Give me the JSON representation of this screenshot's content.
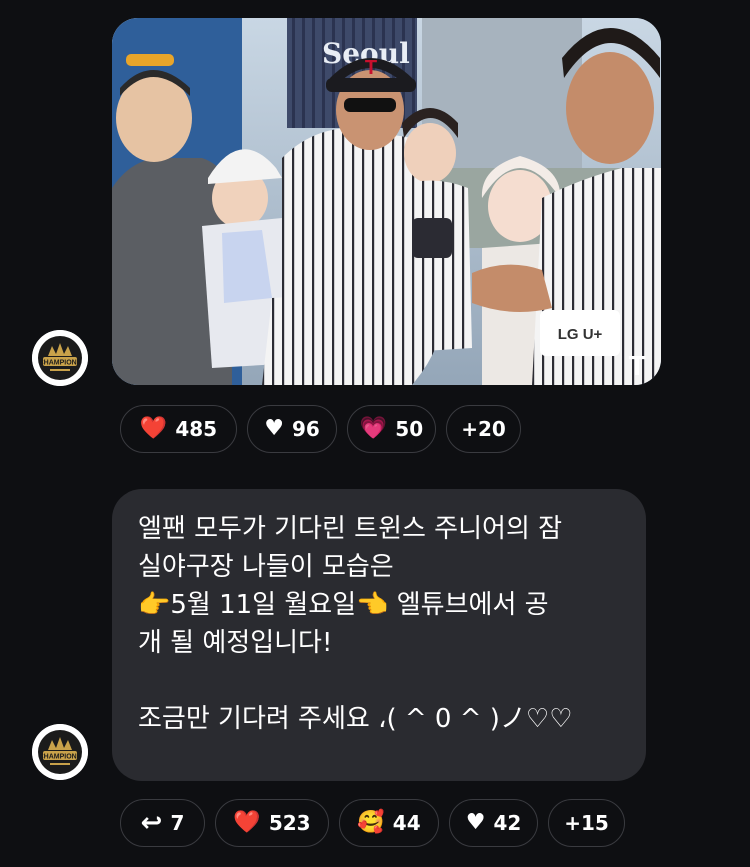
{
  "message1": {
    "avatar_icon": "champions-crown-logo",
    "avatar_text": "CHAMPIONS",
    "photo": {
      "description_icon": "baseball-team-photo",
      "jersey_text": "Seoul",
      "sponsor_text": "LG U+",
      "corner_mark": "T"
    },
    "reactions": [
      {
        "emoji": "❤️",
        "count": "485",
        "icon": "red-heart-icon"
      },
      {
        "emoji": "♥",
        "count": "96",
        "icon": "white-heart-icon"
      },
      {
        "emoji": "💗",
        "count": "50",
        "icon": "pink-heart-icon"
      },
      {
        "emoji": "",
        "count": "+20",
        "icon": ""
      }
    ]
  },
  "message2": {
    "avatar_icon": "champions-crown-logo",
    "avatar_text": "CHAMPIONS",
    "lines": [
      "엘팬 모두가 기다린 트윈스 주니어의 잠",
      "실야구장 나들이 모습은",
      "👉5월 11일 월요일👈 엘튜브에서 공",
      "개 될 예정입니다!",
      "",
      "조금만 기다려 주세요 ،( ^ 0 ^ )ノ♡♡"
    ],
    "reactions": [
      {
        "emoji": "↩",
        "count": "7",
        "icon": "reply-arrow-icon"
      },
      {
        "emoji": "❤️",
        "count": "523",
        "icon": "red-heart-icon"
      },
      {
        "emoji": "🥰",
        "count": "44",
        "icon": "smiling-face-with-hearts-icon"
      },
      {
        "emoji": "♥",
        "count": "42",
        "icon": "white-heart-icon"
      },
      {
        "emoji": "",
        "count": "+15",
        "icon": ""
      }
    ]
  }
}
